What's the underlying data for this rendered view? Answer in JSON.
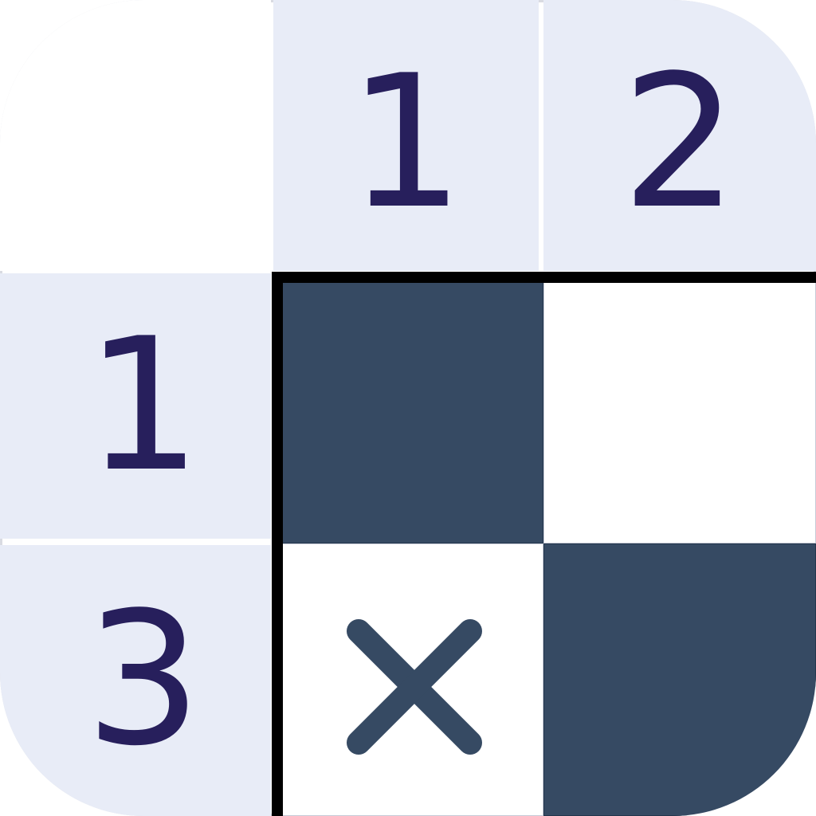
{
  "puzzle": {
    "column_clues": [
      "1",
      "2"
    ],
    "row_clues": [
      "1",
      "3"
    ],
    "cells": [
      [
        "filled",
        "empty"
      ],
      [
        "crossed",
        "filled"
      ]
    ]
  },
  "colors": {
    "clue_background": "#e8ecf7",
    "clue_text": "#271f5c",
    "filled_cell": "#364a63",
    "grid_border": "#000000"
  },
  "icons": {
    "cross_mark": "x-mark-icon"
  }
}
